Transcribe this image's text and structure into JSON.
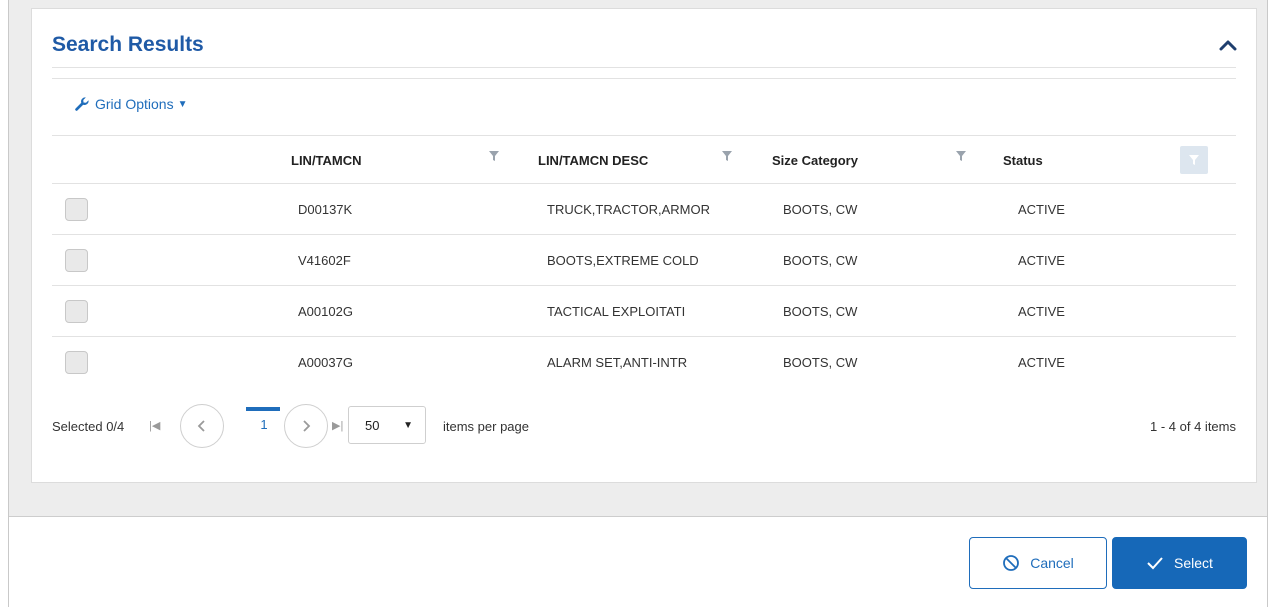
{
  "panel": {
    "title": "Search Results"
  },
  "toolbar": {
    "grid_options_label": "Grid Options",
    "grid_options_icon": "wrench-icon"
  },
  "table": {
    "columns": [
      "LIN/TAMCN",
      "LIN/TAMCN DESC",
      "Size Category",
      "Status"
    ],
    "rows": [
      {
        "lin": "D00137K",
        "desc": "TRUCK,TRACTOR,ARMOR",
        "size": "BOOTS, CW",
        "status": "ACTIVE"
      },
      {
        "lin": "V41602F",
        "desc": "BOOTS,EXTREME COLD",
        "size": "BOOTS, CW",
        "status": "ACTIVE"
      },
      {
        "lin": "A00102G",
        "desc": "TACTICAL EXPLOITATI",
        "size": "BOOTS, CW",
        "status": "ACTIVE"
      },
      {
        "lin": "A00037G",
        "desc": "ALARM SET,ANTI-INTR",
        "size": "BOOTS, CW",
        "status": "ACTIVE"
      }
    ]
  },
  "pager": {
    "selected": "Selected 0/4",
    "current_page": "1",
    "per_page": "50",
    "per_page_label": "items per page",
    "items_count": "1 - 4 of 4 items"
  },
  "footer": {
    "cancel_label": "Cancel",
    "select_label": "Select"
  },
  "colors": {
    "accent": "#1f6dbb",
    "title": "#1f5aa6",
    "primary_button": "#1668b8"
  }
}
